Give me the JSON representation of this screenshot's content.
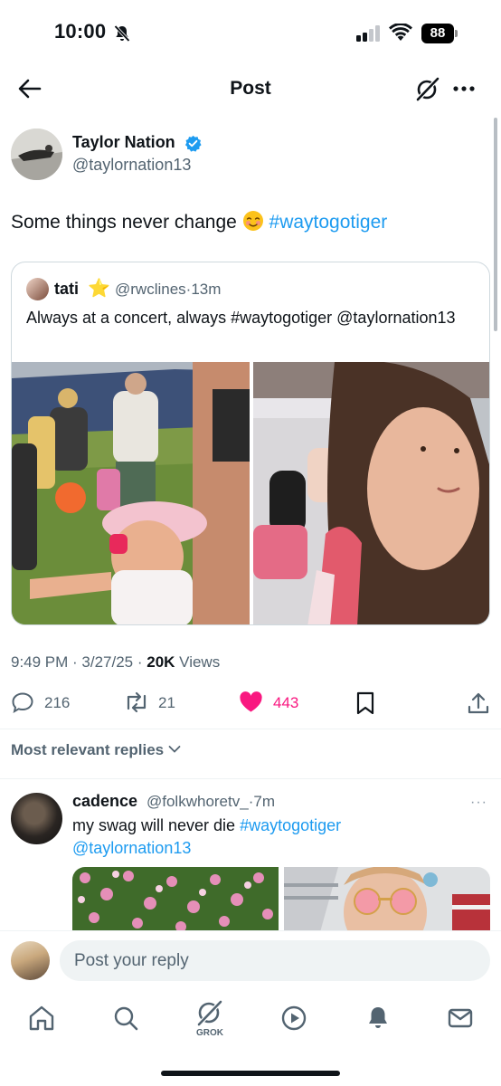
{
  "status_bar": {
    "time": "10:00",
    "battery": "88"
  },
  "header": {
    "title": "Post",
    "icons": [
      "back-arrow-icon",
      "grok-icon",
      "more-icon"
    ]
  },
  "post": {
    "author": {
      "name": "Taylor Nation",
      "handle": "@taylornation13",
      "verified": true
    },
    "text": "Some things never change",
    "emoji": "blush-face",
    "hashtag": "#waytogotiger",
    "quote": {
      "name": "tati",
      "emoji": "⭐",
      "handle": "@rwclines",
      "separator": "·",
      "time": "13m",
      "text": "Always at a concert, always #waytogotiger @taylornation13"
    },
    "meta": {
      "time": "9:49 PM · 3/27/25 · ",
      "views_count": "20K",
      "views_label": " Views"
    },
    "actions": {
      "replies": "216",
      "reposts": "21",
      "likes": "443"
    }
  },
  "replies_filter": {
    "label": "Most relevant replies"
  },
  "reply": {
    "name": "cadence",
    "handle": "@folkwhoretv_",
    "separator": "·",
    "time": "7m",
    "more": "···",
    "text_plain": "my swag will never die ",
    "hashtag": "#waytogotiger",
    "mention": "@taylornation13"
  },
  "composer": {
    "placeholder": "Post your reply"
  },
  "tab_bar": {
    "grok_label": "GROK",
    "tabs": [
      "home",
      "search",
      "grok",
      "video",
      "notifications",
      "messages"
    ]
  },
  "colors": {
    "accent": "#1d9bf0",
    "like": "#f91880",
    "text": "#0f1419",
    "secondary": "#536471"
  }
}
